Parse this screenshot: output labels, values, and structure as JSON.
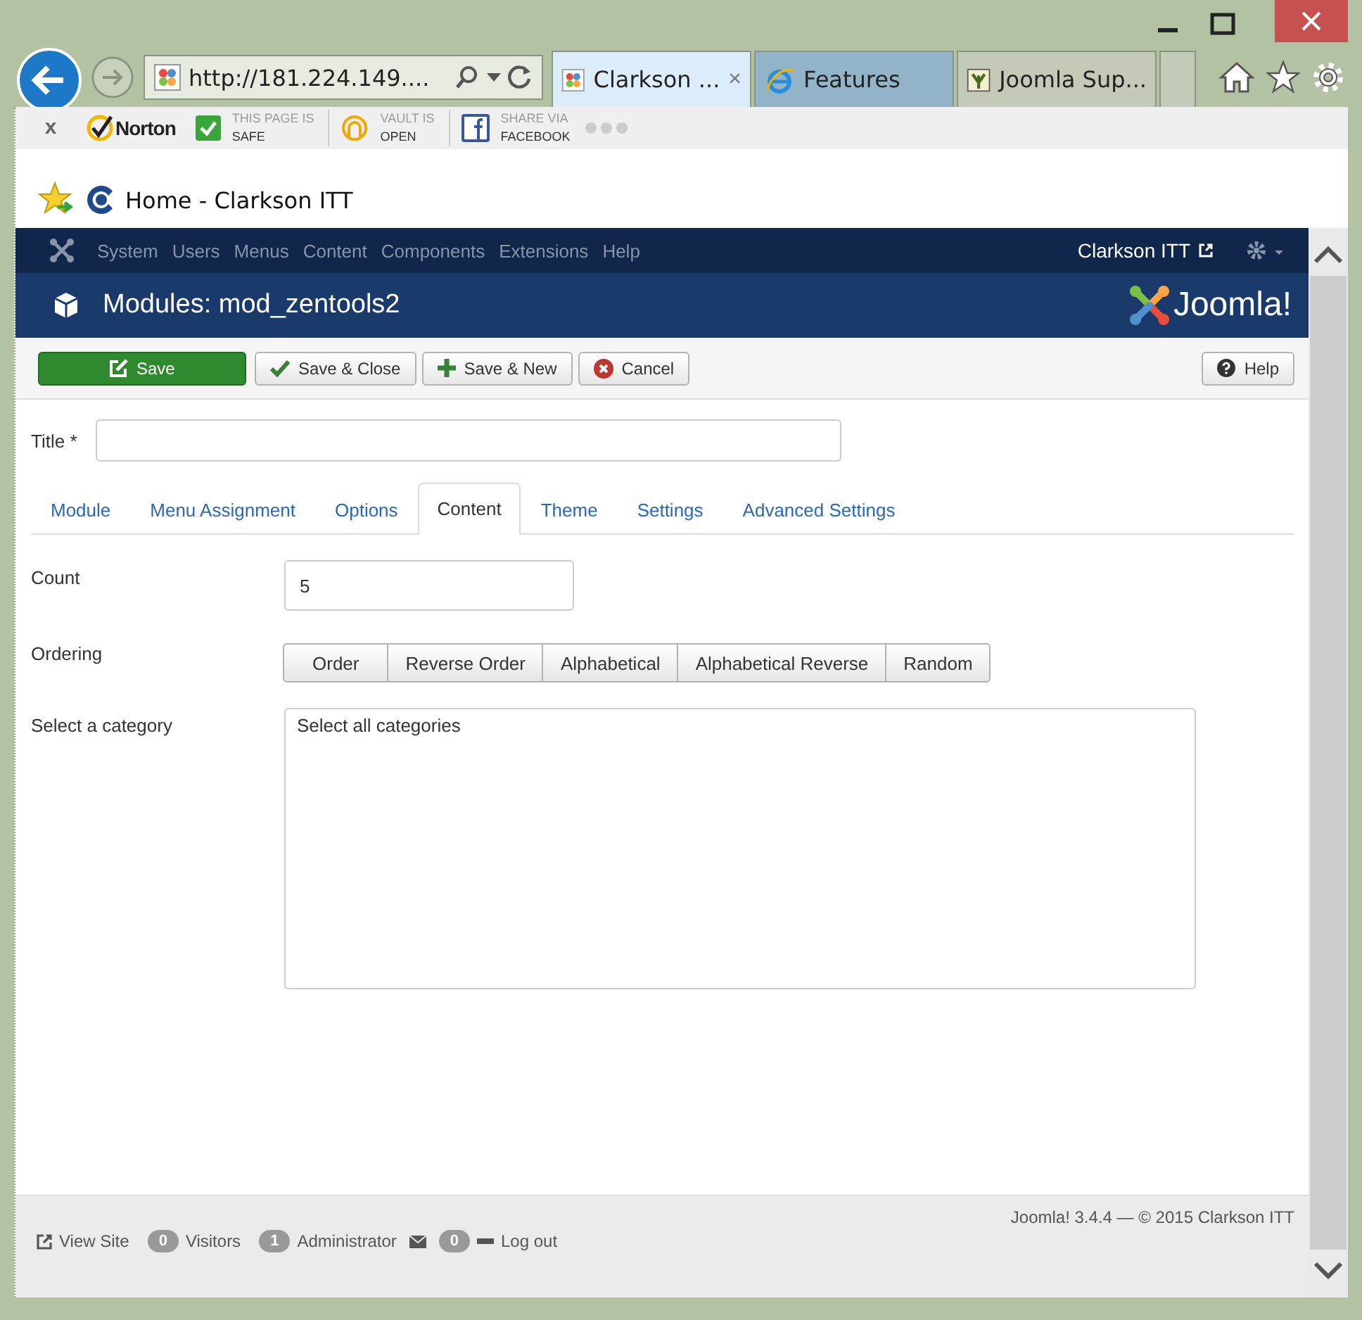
{
  "browser": {
    "address": "http://181.224.149....",
    "tabs": [
      {
        "label": "Clarkson ...",
        "selected": true
      },
      {
        "label": "Features",
        "selected": false
      },
      {
        "label": "Joomla Sup...",
        "selected": false
      }
    ],
    "close_tab": "×"
  },
  "addon_bar": {
    "close": "x",
    "brand": "Norton",
    "items": [
      {
        "top": "THIS PAGE IS",
        "bottom": "SAFE"
      },
      {
        "top": "VAULT IS",
        "bottom": "OPEN"
      },
      {
        "top": "SHARE VIA",
        "bottom": "FACEBOOK"
      }
    ]
  },
  "favorites": {
    "label": "Home - Clarkson ITT"
  },
  "admin_nav": {
    "menu": [
      "System",
      "Users",
      "Menus",
      "Content",
      "Components",
      "Extensions",
      "Help"
    ],
    "site": "Clarkson ITT"
  },
  "header": {
    "title": "Modules: mod_zentools2",
    "logo": "Joomla!"
  },
  "toolbar": {
    "buttons": [
      {
        "label": "Save",
        "kind": "primary"
      },
      {
        "label": "Save & Close",
        "kind": "check"
      },
      {
        "label": "Save & New",
        "kind": "plus"
      },
      {
        "label": "Cancel",
        "kind": "cancel"
      }
    ],
    "help": "Help"
  },
  "form": {
    "title_label": "Title *",
    "tabs": [
      {
        "label": "Module",
        "selected": false
      },
      {
        "label": "Menu Assignment",
        "selected": false
      },
      {
        "label": "Options",
        "selected": false
      },
      {
        "label": "Content",
        "selected": true
      },
      {
        "label": "Theme",
        "selected": false
      },
      {
        "label": "Settings",
        "selected": false
      },
      {
        "label": "Advanced Settings",
        "selected": false
      }
    ],
    "fields": [
      {
        "kind": "text",
        "label": "Count",
        "value": "5"
      },
      {
        "kind": "buttons",
        "label": "Ordering",
        "options": [
          {
            "label": "Order",
            "selected": false
          },
          {
            "label": "Reverse Order",
            "selected": false
          },
          {
            "label": "Alphabetical",
            "selected": false
          },
          {
            "label": "Alphabetical Reverse",
            "selected": false
          },
          {
            "label": "Random",
            "selected": false
          }
        ]
      },
      {
        "kind": "list",
        "label": "Select a category",
        "options": [
          "Select all categories"
        ]
      }
    ]
  },
  "footer": {
    "version": "Joomla! 3.4.4  —  © 2015 Clarkson ITT",
    "view_site": "View Site",
    "visitors_count": "0",
    "visitors": "Visitors",
    "admins_count": "1",
    "admins": "Administrator",
    "messages_count": "0",
    "logout": "Log out"
  }
}
